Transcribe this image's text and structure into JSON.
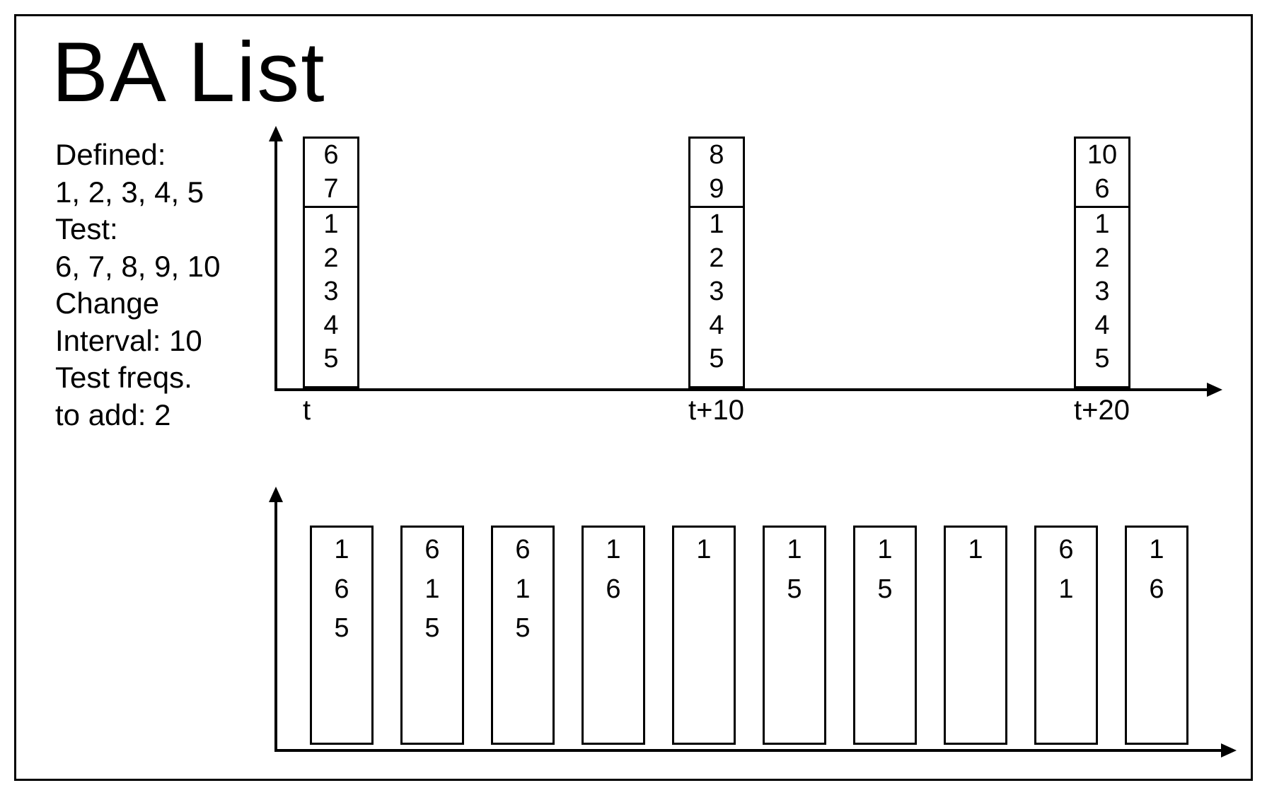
{
  "title": "BA List",
  "sidebar": {
    "defined_label": "Defined:",
    "defined_values": "1, 2, 3, 4, 5",
    "test_label": "Test:",
    "test_values": "6, 7, 8, 9, 10",
    "change_label": "Change",
    "interval_label": "Interval: 10",
    "testfreqs_label": "Test freqs.",
    "toadd_label": "to add: 2"
  },
  "top_chart": {
    "xlabels": [
      "t",
      "t+10",
      "t+20"
    ],
    "columns": [
      {
        "top": [
          "6",
          "7"
        ],
        "bottom": [
          "1",
          "2",
          "3",
          "4",
          "5"
        ]
      },
      {
        "top": [
          "8",
          "9"
        ],
        "bottom": [
          "1",
          "2",
          "3",
          "4",
          "5"
        ]
      },
      {
        "top": [
          "10",
          "6"
        ],
        "bottom": [
          "1",
          "2",
          "3",
          "4",
          "5"
        ]
      }
    ]
  },
  "bottom_chart": {
    "columns": [
      [
        "1",
        "6",
        "5"
      ],
      [
        "6",
        "1",
        "5"
      ],
      [
        "6",
        "1",
        "5"
      ],
      [
        "1",
        "6"
      ],
      [
        "1"
      ],
      [
        "1",
        "5"
      ],
      [
        "1",
        "5"
      ],
      [
        "1"
      ],
      [
        "6",
        "1"
      ],
      [
        "1",
        "6"
      ]
    ]
  }
}
